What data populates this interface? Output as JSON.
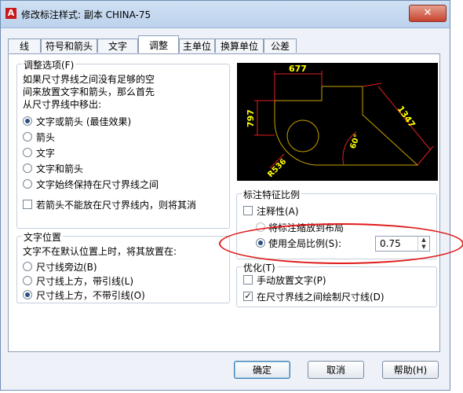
{
  "window": {
    "title": "修改标注样式: 副本 CHINA-75",
    "close_glyph": "✕",
    "app_icon_letter": "A"
  },
  "tabs": [
    {
      "label": "线",
      "active": false
    },
    {
      "label": "符号和箭头",
      "active": false
    },
    {
      "label": "文字",
      "active": false
    },
    {
      "label": "调整",
      "active": true
    },
    {
      "label": "主单位",
      "active": false
    },
    {
      "label": "换算单位",
      "active": false
    },
    {
      "label": "公差",
      "active": false
    }
  ],
  "fit_options": {
    "title": "调整选项(F)",
    "description_lines": [
      "如果尺寸界线之间没有足够的空",
      "间来放置文字和箭头，那么首先",
      "从尺寸界线中移出:"
    ],
    "radios": [
      {
        "label": "文字或箭头 (最佳效果)",
        "checked": true
      },
      {
        "label": "箭头",
        "checked": false
      },
      {
        "label": "文字",
        "checked": false
      },
      {
        "label": "文字和箭头",
        "checked": false
      },
      {
        "label": "文字始终保持在尺寸界线之间",
        "checked": false
      }
    ],
    "checkbox_label": "若箭头不能放在尺寸界线内，则将其消"
  },
  "text_placement": {
    "title": "文字位置",
    "description": "文字不在默认位置上时，将其放置在:",
    "radios": [
      {
        "label": "尺寸线旁边(B)",
        "checked": false
      },
      {
        "label": "尺寸线上方，带引线(L)",
        "checked": false
      },
      {
        "label": "尺寸线上方，不带引线(O)",
        "checked": true
      }
    ]
  },
  "scale": {
    "title": "标注特征比例",
    "annotative_label": "注释性(A)",
    "radio_layout_label": "将标注缩放到布局",
    "radio_global_label": "使用全局比例(S):",
    "global_scale_value": "0.75"
  },
  "fine_tuning": {
    "title": "优化(T)",
    "manual_label": "手动放置文字(P)",
    "draw_line_label": "在尺寸界线之间绘制尺寸线(D)"
  },
  "preview": {
    "dim_top": "677",
    "dim_left": "797",
    "dim_right": "1347",
    "dim_angle": "60°",
    "dim_radius": "R536",
    "colors": {
      "outline": "#c8a000",
      "dim": "#e02020",
      "text": "#ffff00",
      "bg": "#000000"
    }
  },
  "buttons": {
    "ok": "确定",
    "cancel": "取消",
    "help": "帮助(H)"
  },
  "colors": {
    "annotation_ellipse": "#e01b1b",
    "title_bar": "#bcd2ec"
  }
}
